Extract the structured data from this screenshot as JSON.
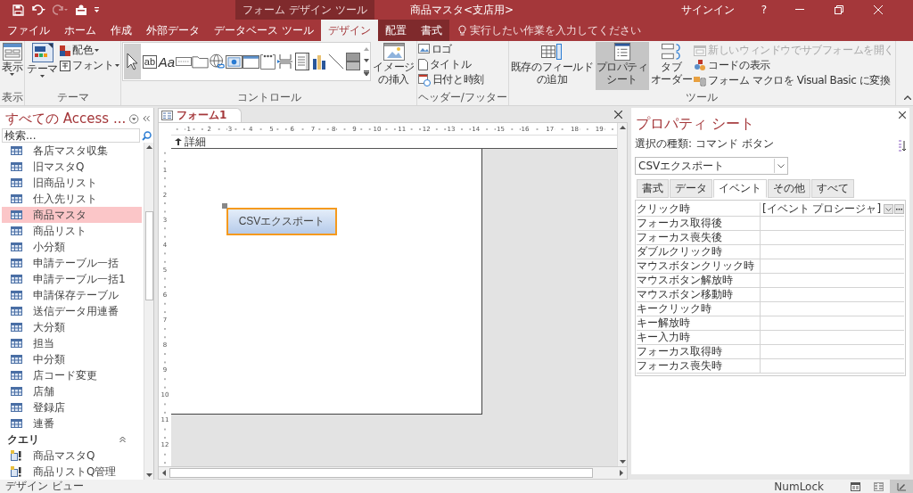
{
  "title_bar": {
    "quick_access": [
      {
        "kind": "save",
        "disabled": false
      },
      {
        "kind": "undo",
        "disabled": false
      },
      {
        "kind": "redo",
        "disabled": true
      },
      {
        "kind": "form",
        "disabled": false
      },
      {
        "kind": "customize",
        "disabled": false
      }
    ],
    "context_label": "フォーム デザイン ツール",
    "title": "商品マスタ<支店用>",
    "sign_in": "サインイン",
    "help": "?"
  },
  "menu_tabs": [
    {
      "label": "ファイル",
      "selected": false,
      "contextual": false
    },
    {
      "label": "ホーム",
      "selected": false,
      "contextual": false
    },
    {
      "label": "作成",
      "selected": false,
      "contextual": false
    },
    {
      "label": "外部データ",
      "selected": false,
      "contextual": false
    },
    {
      "label": "データベース ツール",
      "selected": false,
      "contextual": false
    },
    {
      "label": "デザイン",
      "selected": true,
      "contextual": true
    },
    {
      "label": "配置",
      "selected": false,
      "contextual": true
    },
    {
      "label": "書式",
      "selected": false,
      "contextual": true
    }
  ],
  "tell_me": {
    "placeholder": "実行したい作業を入力してください"
  },
  "ribbon": {
    "view_group": {
      "label": "表示",
      "button": "表示"
    },
    "theme_group": {
      "label": "テーマ",
      "theme": "テーマ",
      "colors": "配色",
      "fonts": "フォント"
    },
    "controls_group": {
      "label": "コントロール",
      "insert_image": [
        "イメージ",
        "の挿入"
      ],
      "controls": [
        {
          "kind": "pointer",
          "selected": true
        },
        {
          "kind": "textbox",
          "glyph": "ab",
          "selected": false
        },
        {
          "kind": "label",
          "glyph": "Aa",
          "selected": false
        },
        {
          "kind": "button",
          "selected": false
        },
        {
          "kind": "tab",
          "selected": false
        },
        {
          "kind": "link",
          "selected": false
        },
        {
          "kind": "webbrowser",
          "selected": false
        },
        {
          "kind": "navigation",
          "selected": false
        },
        {
          "kind": "optiongroup",
          "selected": false
        },
        {
          "kind": "pagebreak",
          "selected": false
        },
        {
          "kind": "combobox",
          "selected": false
        },
        {
          "kind": "chart",
          "selected": false
        },
        {
          "kind": "line",
          "selected": false
        },
        {
          "kind": "toggle",
          "selected": false
        }
      ]
    },
    "header_footer_group": {
      "label": "ヘッダー/フッター",
      "items": [
        {
          "kind": "logo",
          "label": "ロゴ"
        },
        {
          "kind": "title",
          "label": "タイトル"
        },
        {
          "kind": "datetime",
          "label": "日付と時刻"
        }
      ]
    },
    "tools_group": {
      "label": "ツール",
      "large": [
        {
          "kind": "fields",
          "label": [
            "既存のフィールド",
            "の追加"
          ],
          "selected": false
        },
        {
          "kind": "property_sheet",
          "label": [
            "プロパティ",
            "シート"
          ],
          "selected": true
        },
        {
          "kind": "tab_order",
          "label": [
            "タブ",
            "オーダー"
          ],
          "selected": false
        }
      ],
      "small": [
        {
          "kind": "subform",
          "label": "新しいウィンドウでサブフォームを開く",
          "disabled": true
        },
        {
          "kind": "code",
          "label": "コードの表示",
          "disabled": false
        },
        {
          "kind": "macro",
          "label": "フォーム マクロを Visual Basic に変換",
          "disabled": false
        }
      ]
    }
  },
  "nav": {
    "title": "すべての Access ...",
    "search": {
      "placeholder": "検索..."
    },
    "tables": [
      {
        "label": "各店マスタ収集",
        "selected": false
      },
      {
        "label": "旧マスタQ",
        "selected": false
      },
      {
        "label": "旧商品リスト",
        "selected": false
      },
      {
        "label": "仕入先リスト",
        "selected": false
      },
      {
        "label": "商品マスタ",
        "selected": true
      },
      {
        "label": "商品リスト",
        "selected": false
      },
      {
        "label": "小分類",
        "selected": false
      },
      {
        "label": "申請テーブル一括",
        "selected": false
      },
      {
        "label": "申請テーブル一括1",
        "selected": false
      },
      {
        "label": "申請保存テーブル",
        "selected": false
      },
      {
        "label": "送信データ用連番",
        "selected": false
      },
      {
        "label": "大分類",
        "selected": false
      },
      {
        "label": "担当",
        "selected": false
      },
      {
        "label": "中分類",
        "selected": false
      },
      {
        "label": "店コード変更",
        "selected": false
      },
      {
        "label": "店舗",
        "selected": false
      },
      {
        "label": "登録店",
        "selected": false
      },
      {
        "label": "連番",
        "selected": false
      }
    ],
    "query_header": "クエリ",
    "queries": [
      {
        "label": "商品マスタQ",
        "selected": false
      },
      {
        "label": "商品リストQ管理",
        "selected": false
      }
    ]
  },
  "document": {
    "tab": "フォーム1",
    "section": "詳細",
    "ruler_h": [
      "1",
      "2",
      "3",
      "4",
      "5",
      "6",
      "7",
      "8",
      "9",
      "10",
      "11",
      "12",
      "13",
      "14",
      "15",
      "16",
      "17",
      "18",
      "19"
    ],
    "ruler_v": [
      "1",
      "2",
      "3",
      "4",
      "5",
      "6",
      "7",
      "8",
      "9",
      "10",
      "11",
      "12"
    ],
    "button": {
      "label": "CSVエクスポート",
      "selected": true
    }
  },
  "property_sheet": {
    "title": "プロパティ シート",
    "selection_type": "選択の種類: コマンド ボタン",
    "object": "CSVエクスポート",
    "tabs": [
      {
        "label": "書式",
        "selected": false
      },
      {
        "label": "データ",
        "selected": false
      },
      {
        "label": "イベント",
        "selected": true
      },
      {
        "label": "その他",
        "selected": false
      },
      {
        "label": "すべて",
        "selected": false
      }
    ],
    "rows": [
      {
        "name": "クリック時",
        "value": "[イベント プロシージャ]",
        "selected": true
      },
      {
        "name": "フォーカス取得後",
        "selected": false
      },
      {
        "name": "フォーカス喪失後",
        "selected": false
      },
      {
        "name": "ダブルクリック時",
        "selected": false
      },
      {
        "name": "マウスボタンクリック時",
        "selected": false
      },
      {
        "name": "マウスボタン解放時",
        "selected": false
      },
      {
        "name": "マウスボタン移動時",
        "selected": false
      },
      {
        "name": "キークリック時",
        "selected": false
      },
      {
        "name": "キー解放時",
        "selected": false
      },
      {
        "name": "キー入力時",
        "selected": false
      },
      {
        "name": "フォーカス取得時",
        "selected": false
      },
      {
        "name": "フォーカス喪失時",
        "selected": false
      }
    ]
  },
  "status_bar": {
    "text": "デザイン ビュー",
    "num_lock": "NumLock",
    "views": [
      {
        "kind": "form",
        "selected": false
      },
      {
        "kind": "layout",
        "selected": false
      },
      {
        "kind": "design",
        "selected": true
      }
    ]
  }
}
